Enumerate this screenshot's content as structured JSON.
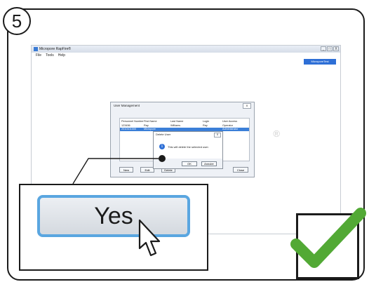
{
  "step": {
    "number": "5"
  },
  "app": {
    "window_title": "Micropore RapFire®",
    "window_buttons": [
      "_",
      "□",
      "X"
    ],
    "menu": [
      "File",
      "Tools",
      "Help"
    ],
    "user_badge": "MicroporeTest (Administrator)",
    "watermark": "®"
  },
  "user_management": {
    "title": "User Management",
    "close_label": "X",
    "columns": [
      "Personnel Number",
      "First Name",
      "Last Name",
      "Login",
      "User Access"
    ],
    "rows": [
      [
        "123456",
        "Ray",
        "Williams",
        "Ray",
        "Operator"
      ],
      [
        "2010101000",
        "Micropore",
        "",
        "",
        "Administrator"
      ]
    ],
    "buttons": {
      "new": "New",
      "edit": "Edit",
      "delete": "Delete",
      "close": "Close"
    }
  },
  "delete_confirm": {
    "title": "Delete User",
    "close_label": "X",
    "message": "This will delete the selected user.",
    "ok_label": "OK",
    "cancel_label": "Annuler"
  },
  "zoom": {
    "yes_label": "Yes"
  },
  "colors": {
    "accent_blue": "#2e6fd6",
    "zoom_button_border": "#5aa6e0",
    "checkmark_green": "#52a935"
  },
  "icons": [
    "info-icon",
    "mouse-pointer-icon",
    "checkmark-icon"
  ]
}
